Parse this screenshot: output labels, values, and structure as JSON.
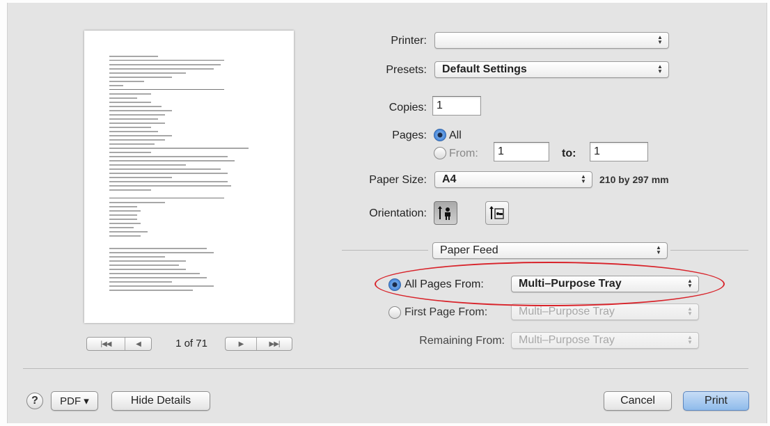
{
  "preview": {
    "page_indicator": "1 of 71",
    "nav_back_labels": [
      "|◀◀",
      "◀"
    ],
    "nav_forward_labels": [
      "▶",
      "▶▶|"
    ]
  },
  "printer": {
    "label": "Printer:",
    "value": ""
  },
  "presets": {
    "label": "Presets:",
    "value": "Default Settings"
  },
  "copies": {
    "label": "Copies:",
    "value": "1"
  },
  "pages": {
    "label": "Pages:",
    "all_label": "All",
    "from_label": "From:",
    "from_value": "1",
    "to_label": "to:",
    "to_value": "1",
    "selected": "All"
  },
  "paper_size": {
    "label": "Paper Size:",
    "value": "A4",
    "dimensions": "210 by 297 mm"
  },
  "orientation": {
    "label": "Orientation:",
    "selected": "portrait"
  },
  "section_menu": {
    "value": "Paper Feed"
  },
  "paper_feed": {
    "all_pages_label": "All Pages From:",
    "all_pages_value": "Multi–Purpose Tray",
    "first_page_label": "First Page From:",
    "first_page_value": "Multi–Purpose Tray",
    "remaining_label": "Remaining From:",
    "remaining_value": "Multi–Purpose Tray",
    "selected": "all_pages"
  },
  "footer": {
    "help_label": "?",
    "pdf_label": "PDF ▾",
    "hide_details_label": "Hide Details",
    "cancel_label": "Cancel",
    "print_label": "Print"
  },
  "colors": {
    "dialog_bg": "#e4e4e4",
    "highlight_oval": "#d8232a",
    "radio_selected": "#3b7dd8",
    "default_button": "#8fbbeb"
  },
  "popup_arrow_glyph": "▲▼"
}
